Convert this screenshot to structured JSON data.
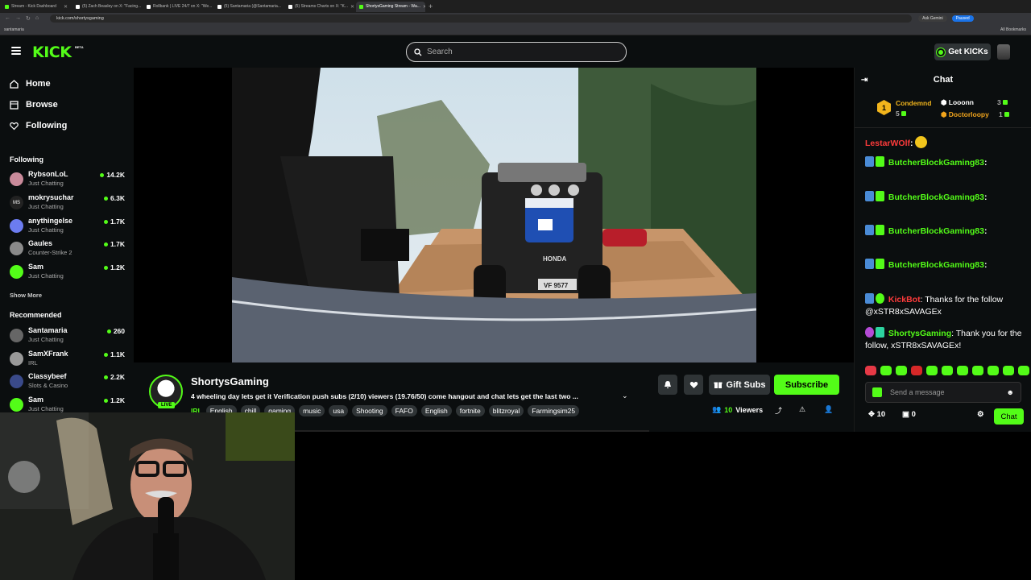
{
  "browser": {
    "tabs": [
      {
        "title": "Stream - Kick Dashboard",
        "active": false
      },
      {
        "title": "(5) Zach Beasley on X: \"Facing...",
        "active": false
      },
      {
        "title": "Rollbank | LIVE 24/7 on X: \"We...",
        "active": false
      },
      {
        "title": "(5) Santamaria (@Santamaria...",
        "active": false
      },
      {
        "title": "(5) Streams Charts on X: \"K...",
        "active": false
      },
      {
        "title": "ShortysGaming Stream - Wa...",
        "active": true
      }
    ],
    "url": "kick.com/shortysgaming",
    "gemini_label": "Ask Gemini",
    "paused_label": "Paused",
    "bookmark_left": "santamaria",
    "bookmark_right": "All Bookmarks"
  },
  "header": {
    "logo": "KICK",
    "beta": "BETA",
    "search_placeholder": "Search",
    "get_kicks": "Get KICKs"
  },
  "sidebar": {
    "nav": [
      {
        "label": "Home",
        "icon": "home-icon"
      },
      {
        "label": "Browse",
        "icon": "browse-icon"
      },
      {
        "label": "Following",
        "icon": "heart-icon"
      }
    ],
    "following_heading": "Following",
    "following": [
      {
        "name": "RybsonLoL",
        "category": "Just Chatting",
        "viewers": "14.2K",
        "color": "#c98a9a"
      },
      {
        "name": "mokrysuchar",
        "category": "Just Chatting",
        "viewers": "6.3K",
        "color": "#2a2a2a",
        "initials": "MS"
      },
      {
        "name": "anythingelse",
        "category": "Just Chatting",
        "viewers": "1.7K",
        "color": "#6c7cf0"
      },
      {
        "name": "Gaules",
        "category": "Counter-Strike 2",
        "viewers": "1.7K",
        "color": "#8a8a8a"
      },
      {
        "name": "Sam",
        "category": "Just Chatting",
        "viewers": "1.2K",
        "color": "#53fc18"
      }
    ],
    "show_more": "Show More",
    "recommended_heading": "Recommended",
    "recommended": [
      {
        "name": "Santamaria",
        "category": "Just Chatting",
        "viewers": "260",
        "color": "#666"
      },
      {
        "name": "SamXFrank",
        "category": "IRL",
        "viewers": "1.1K",
        "color": "#999"
      },
      {
        "name": "Classybeef",
        "category": "Slots & Casino",
        "viewers": "2.2K",
        "color": "#3a4a8a"
      },
      {
        "name": "Sam",
        "category": "Just Chatting",
        "viewers": "1.2K",
        "color": "#53fc18"
      }
    ]
  },
  "stream": {
    "channel": "ShortysGaming",
    "live": "LIVE",
    "title": "4 wheeling day lets get it Verification push subs (2/10) viewers (19.76/50) come hangout and chat lets get the last two ...",
    "category": "IRL",
    "tags": [
      "English",
      "chill",
      "gaming",
      "music",
      "usa",
      "Shooting",
      "FAFO",
      "English",
      "fortnite",
      "blitzroyal",
      "Farmingsim25"
    ],
    "gift_subs": "Gift Subs",
    "subscribe": "Subscribe",
    "viewer_count": "10",
    "viewers_label": "Viewers",
    "plate": "VF 9577",
    "vehicle_brand": "HONDA"
  },
  "chat": {
    "title": "Chat",
    "leaderboard": [
      {
        "rank": "1",
        "name": "Condemnd",
        "count": "5",
        "color": "#f2b51c"
      },
      {
        "name": "Looonn",
        "count": "3",
        "color": "#ffffff"
      },
      {
        "name": "Doctorloopy",
        "count": "1",
        "color": "#f2a51c"
      }
    ],
    "messages": [
      {
        "user": "LestarWOlf",
        "color": "#ff3b3b",
        "text": ""
      },
      {
        "user": "ButcherBlockGaming83",
        "color": "#53fc18",
        "text": ""
      },
      {
        "user": "ButcherBlockGaming83",
        "color": "#53fc18",
        "text": ""
      },
      {
        "user": "ButcherBlockGaming83",
        "color": "#53fc18",
        "text": ""
      },
      {
        "user": "ButcherBlockGaming83",
        "color": "#53fc18",
        "text": ""
      },
      {
        "user": "KickBot",
        "color": "#ff3b3b",
        "text": "Thanks for the follow @xSTR8xSAVAGEx"
      },
      {
        "user": "ShortysGaming",
        "color": "#53fc18",
        "text": "Thank you for the follow, xSTR8xSAVAGEx!"
      }
    ],
    "input_placeholder": "Send a message",
    "kicks_count": "10",
    "gift_count": "0",
    "chat_button": "Chat"
  },
  "colors": {
    "accent": "#53fc18",
    "bg": "#0b0e0f",
    "panel": "#2f3436"
  }
}
